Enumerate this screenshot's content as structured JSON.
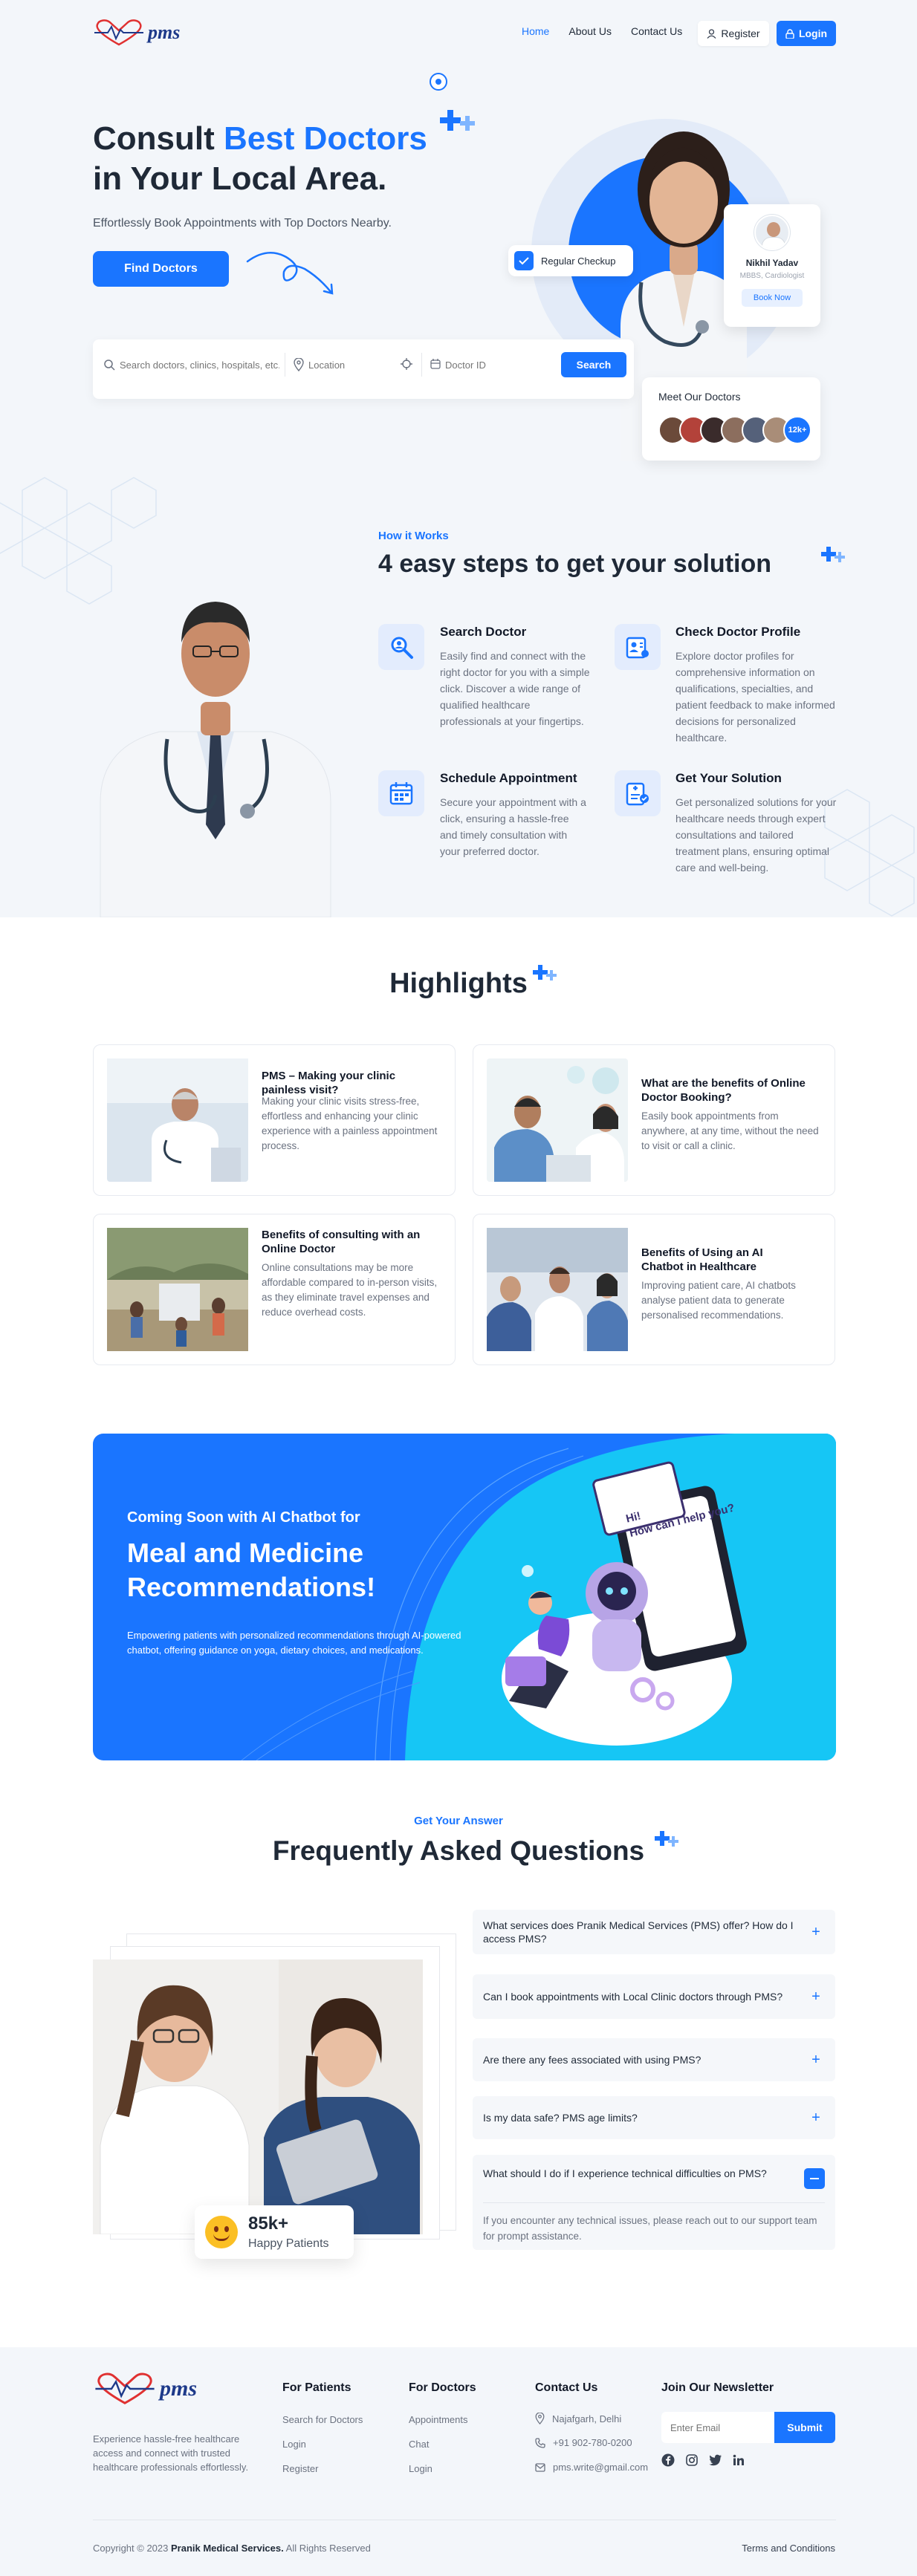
{
  "header": {
    "logo_text": "pms",
    "nav": [
      "Home",
      "About Us",
      "Contact Us"
    ],
    "register_label": "Register",
    "login_label": "Login"
  },
  "hero": {
    "title_part1": "Consult ",
    "title_highlight": "Best Doctors",
    "title_part2": "in Your Local Area.",
    "subtitle": "Effortlessly Book Appointments with Top Doctors Nearby.",
    "cta_label": "Find Doctors",
    "search": {
      "query_placeholder": "Search doctors, clinics, hospitals, etc.",
      "location_placeholder": "Location",
      "doctor_id_placeholder": "Doctor ID",
      "button_label": "Search"
    },
    "checkup_badge": "Regular Checkup",
    "doctor_card": {
      "name": "Nikhil Yadav",
      "title": "MBBS, Cardiologist",
      "button": "Book Now"
    },
    "meet_doctors": {
      "title": "Meet Our Doctors",
      "count_badge": "12k+"
    }
  },
  "how": {
    "eyebrow": "How it Works",
    "title": "4 easy steps to get your solution",
    "steps": [
      {
        "title": "Search Doctor",
        "text": "Easily find and connect with the right doctor for you with a simple click. Discover a wide range of qualified healthcare professionals at your fingertips."
      },
      {
        "title": "Check Doctor Profile",
        "text": "Explore doctor profiles for comprehensive information on qualifications, specialties, and patient feedback to make informed decisions for personalized healthcare."
      },
      {
        "title": "Schedule Appointment",
        "text": "Secure your appointment with a click, ensuring a hassle-free and timely consultation with your preferred doctor."
      },
      {
        "title": "Get Your Solution",
        "text": "Get personalized solutions for your healthcare needs through expert consultations and tailored treatment plans, ensuring optimal care and well-being."
      }
    ]
  },
  "highlights": {
    "title": "Highlights",
    "items": [
      {
        "title": "PMS – Making your clinic painless visit?",
        "text": "Making your clinic visits stress-free, effortless and enhancing your clinic experience with a painless appointment process."
      },
      {
        "title": "What are the benefits of Online Doctor Booking?",
        "text": "Easily book appointments from anywhere, at any time, without the need to visit or call a clinic."
      },
      {
        "title": "Benefits of consulting with an Online Doctor",
        "text": "Online consultations may be more affordable compared to in-person visits, as they eliminate travel expenses and reduce overhead costs."
      },
      {
        "title": "Benefits of Using an AI Chatbot in Healthcare",
        "text": "Improving patient care, AI chatbots analyse patient data to generate personalised recommendations."
      }
    ]
  },
  "banner": {
    "eyebrow": "Coming Soon with AI Chatbot for",
    "title": "Meal and Medicine Recommendations!",
    "text": "Empowering patients with personalized recommendations through AI-powered chatbot, offering guidance on yoga, dietary choices, and medications.",
    "bubble_line1": "Hi!",
    "bubble_line2": "How can i help you?"
  },
  "faq": {
    "eyebrow": "Get Your Answer",
    "title": "Frequently Asked Questions",
    "stat_value": "85k+",
    "stat_label": "Happy Patients",
    "items": [
      {
        "q": "What services does Pranik Medical Services (PMS) offer? How do I access PMS?",
        "open": false
      },
      {
        "q": "Can I book appointments with Local Clinic doctors through PMS?",
        "open": false
      },
      {
        "q": "Are there any fees associated with using PMS?",
        "open": false
      },
      {
        "q": "Is my data safe? PMS age limits?",
        "open": false
      },
      {
        "q": "What should I do if I experience technical difficulties on PMS?",
        "open": true,
        "a": "If you encounter any technical issues, please reach out to our support team for prompt assistance."
      }
    ]
  },
  "footer": {
    "logo_text": "pms",
    "about": "Experience hassle-free healthcare access and connect with trusted healthcare professionals effortlessly.",
    "patients": {
      "title": "For Patients",
      "links": [
        "Search for Doctors",
        "Login",
        "Register"
      ]
    },
    "doctors": {
      "title": "For Doctors",
      "links": [
        "Appointments",
        "Chat",
        "Login"
      ]
    },
    "contact": {
      "title": "Contact Us",
      "address": "Najafgarh, Delhi",
      "phone": "+91 902-780-0200",
      "email": "pms.write@gmail.com"
    },
    "newsletter": {
      "title": "Join Our Newsletter",
      "placeholder": "Enter Email",
      "button": "Submit"
    },
    "copyright_pre": "Copyright © 2023 ",
    "copyright_brand": "Pranik Medical Services.",
    "copyright_post": " All Rights Reserved",
    "terms": "Terms and Conditions"
  },
  "colors": {
    "primary": "#1a75ff",
    "hero_bg": "#f3f6fa",
    "banner_blue": "#1a75ff",
    "banner_cyan": "#16c6f5"
  }
}
